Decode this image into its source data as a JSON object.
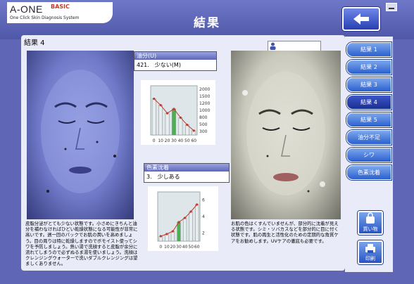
{
  "app": {
    "logo": "A-ONE",
    "logo_badge": "BASIC",
    "logo_sub": "One Click Skin Diagnosis System",
    "title": "結果"
  },
  "result_label": "結果 4",
  "oil": {
    "header": "油分(U)",
    "value": "421.　少ない(M)",
    "chart_data": {
      "type": "bar",
      "categories": [
        "0",
        "10",
        "20",
        "30",
        "40",
        "50",
        "60"
      ],
      "values": [
        1550,
        1330,
        1050,
        1200,
        900,
        650,
        450
      ],
      "highlight_index": 3,
      "ylabel_ticks": [
        "300",
        "500",
        "800",
        "1000",
        "1200",
        "1500",
        "2000"
      ],
      "ylim": [
        300,
        2000
      ]
    }
  },
  "pigment": {
    "header": "色素沈着",
    "value": "3.　少しある",
    "chart_data": {
      "type": "bar",
      "categories": [
        "0",
        "10",
        "20",
        "30",
        "40",
        "50",
        "60"
      ],
      "values": [
        0.7,
        1.0,
        1.4,
        2.7,
        3.3,
        4.2,
        5.2
      ],
      "highlight_index": 3,
      "ylabel_ticks": [
        "2",
        "4",
        "6"
      ],
      "ylim": [
        0,
        7
      ]
    }
  },
  "desc_left": "皮脂分泌がとても少ない状態です。小さめにきちんと油分を補わなければひどい乾燥状態になる可能性が非常に高いです。週一回のパックでお肌の潤いを高めましょう。目の周りは特に乾燥しますのでボモイスト使ってシワを予防しましょう。熱い湯で洗顔すると皮脂が余分に流れてしまうので必ずぬるま湯を使いましょう。洗顔はクレンジングウォーターで洗いダブルクレンジングは望ましくありません。",
  "desc_right": "お肌の色はくすんでいませんが、部分的に沈着が見える状態です。シミ・ソバカスなどを部分的に目に付く状態です。肌の再生と活性化のための定期的な角質ケアをお勧めします。UVケアの徹底も必要です。",
  "sidebar": {
    "items": [
      {
        "label": "結果 1"
      },
      {
        "label": "結果 2"
      },
      {
        "label": "結果 3"
      },
      {
        "label": "結果 4"
      },
      {
        "label": "結果 5"
      },
      {
        "label": "油分不足"
      },
      {
        "label": "シワ"
      },
      {
        "label": "色素沈着"
      }
    ],
    "active_index": 3,
    "buy_label": "買い物",
    "print_label": "印刷"
  }
}
